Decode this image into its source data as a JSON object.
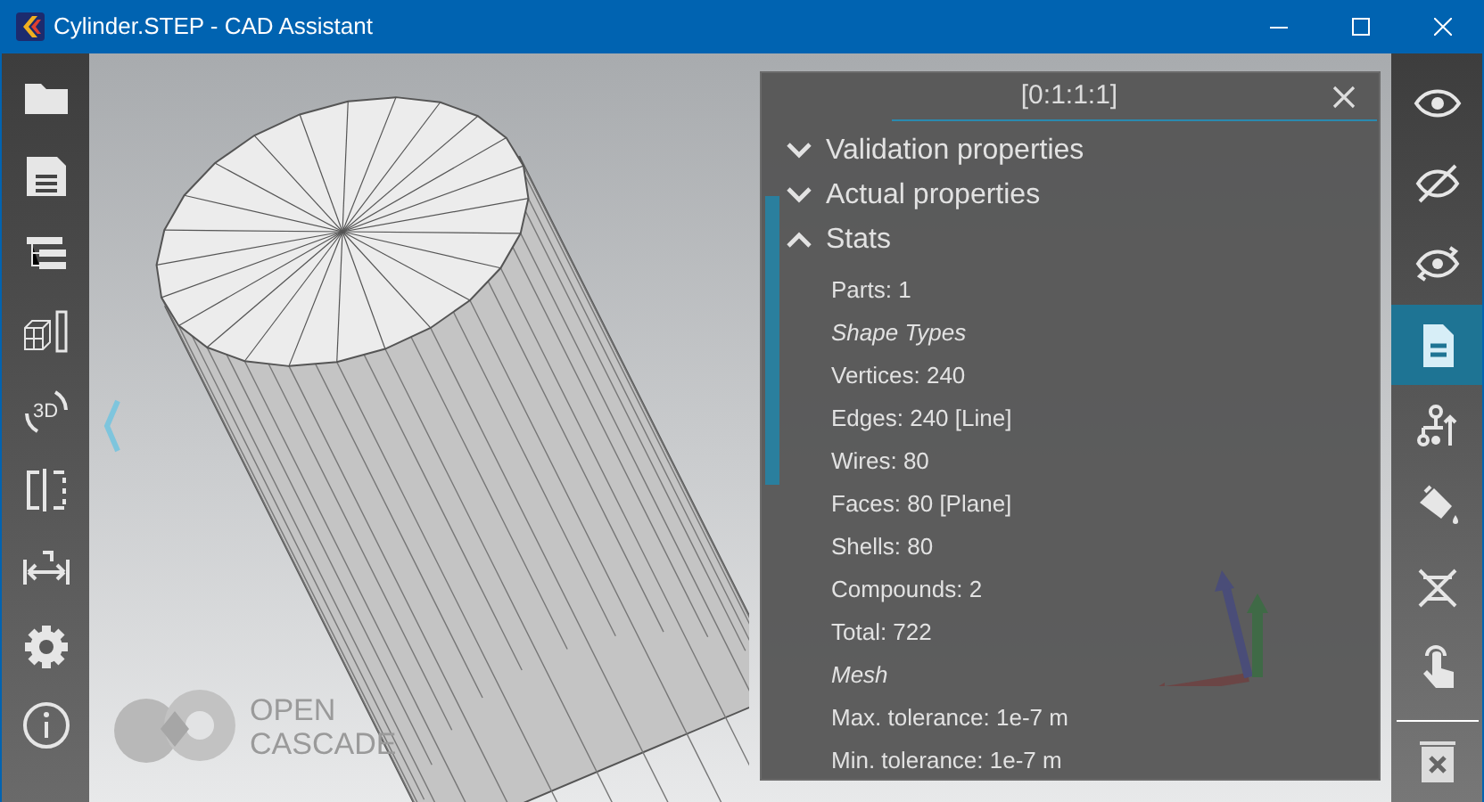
{
  "window": {
    "title": "Cylinder.STEP - CAD Assistant"
  },
  "left_toolbar": [
    {
      "kind": "folder"
    },
    {
      "kind": "save"
    },
    {
      "kind": "tree"
    },
    {
      "kind": "cube"
    },
    {
      "kind": "rotate3d",
      "label": "3D"
    },
    {
      "kind": "split"
    },
    {
      "kind": "measure"
    },
    {
      "kind": "gear"
    },
    {
      "kind": "info"
    }
  ],
  "right_toolbar": [
    {
      "kind": "eye",
      "selected": false
    },
    {
      "kind": "eye-off",
      "selected": false
    },
    {
      "kind": "eye-swap",
      "selected": false
    },
    {
      "kind": "document",
      "selected": true
    },
    {
      "kind": "hierarchy",
      "selected": false
    },
    {
      "kind": "paint",
      "selected": false
    },
    {
      "kind": "cross",
      "selected": false
    },
    {
      "kind": "hand",
      "selected": false
    },
    {
      "kind": "trash",
      "selected": false
    }
  ],
  "logo": {
    "line_1": "OPEN",
    "line_2": "CASCADE"
  },
  "panel": {
    "title": "[0:1:1:1]",
    "sections": [
      {
        "label": "Validation properties",
        "expanded": false
      },
      {
        "label": "Actual properties",
        "expanded": false
      },
      {
        "label": "Stats",
        "expanded": true
      }
    ],
    "stats": [
      {
        "kind": "line",
        "text": "Parts: 1"
      },
      {
        "kind": "heading",
        "text": "Shape Types"
      },
      {
        "kind": "line",
        "text": "Vertices: 240"
      },
      {
        "kind": "line",
        "text": "Edges: 240 [Line]"
      },
      {
        "kind": "line",
        "text": "Wires: 80"
      },
      {
        "kind": "line",
        "text": "Faces: 80 [Plane]"
      },
      {
        "kind": "line",
        "text": "Shells: 80"
      },
      {
        "kind": "line",
        "text": "Compounds: 2"
      },
      {
        "kind": "line",
        "text": "Total: 722"
      },
      {
        "kind": "heading",
        "text": "Mesh"
      },
      {
        "kind": "line",
        "text": "Max. tolerance: 1e-7 m"
      },
      {
        "kind": "line",
        "text": "Min. tolerance: 1e-7 m"
      }
    ]
  }
}
